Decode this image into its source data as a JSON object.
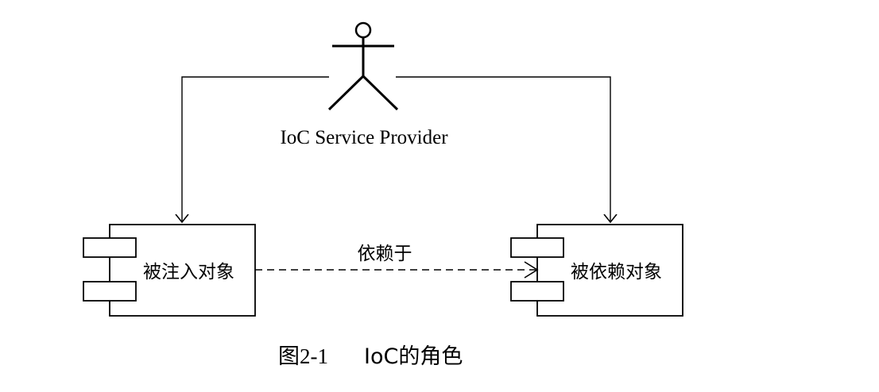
{
  "actor": {
    "name": "IoC Service Provider",
    "icon": "stick-figure-actor-icon"
  },
  "components": [
    {
      "id": "injected",
      "label": "被注入对象",
      "icon": "uml-component-icon"
    },
    {
      "id": "dependent",
      "label": "被依赖对象",
      "icon": "uml-component-icon"
    }
  ],
  "relations": [
    {
      "from": "IoC Service Provider",
      "to": "被注入对象",
      "style": "solid",
      "arrow": "open"
    },
    {
      "from": "IoC Service Provider",
      "to": "被依赖对象",
      "style": "solid",
      "arrow": "open"
    },
    {
      "from": "被注入对象",
      "to": "被依赖对象",
      "style": "dashed",
      "arrow": "open",
      "label": "依赖于"
    }
  ],
  "caption": {
    "number": "图2-1",
    "text": "IoC的角色"
  },
  "colors": {
    "stroke": "#000000",
    "background": "#ffffff"
  }
}
